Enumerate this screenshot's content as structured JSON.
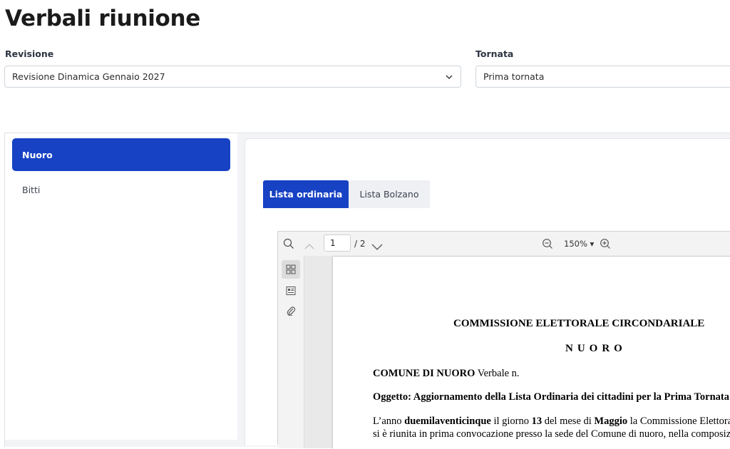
{
  "page": {
    "title": "Verbali riunione"
  },
  "filters": {
    "revisione": {
      "label": "Revisione",
      "value": "Revisione Dinamica Gennaio 2027"
    },
    "tornata": {
      "label": "Tornata",
      "value": "Prima tornata"
    }
  },
  "sidebar": {
    "items": [
      {
        "label": "Nuoro",
        "active": true
      },
      {
        "label": "Bitti",
        "active": false
      }
    ]
  },
  "tabs": [
    {
      "label": "Lista ordinaria",
      "active": true
    },
    {
      "label": "Lista Bolzano",
      "active": false
    }
  ],
  "viewer": {
    "current_page": "1",
    "total_pages": "/ 2",
    "zoom": "150%",
    "zoom_caret": "▾",
    "icons": [
      "search-icon",
      "chevron-up-icon",
      "chevron-down-icon",
      "zoom-out-icon",
      "zoom-in-icon",
      "thumbnails-icon",
      "outline-icon",
      "attachment-icon"
    ]
  },
  "document": {
    "heading": "COMMISSIONE ELETTORALE CIRCONDARIALE",
    "subheading": "NUORO",
    "comune_bold": "COMUNE DI NUORO",
    "comune_rest": " Verbale n.",
    "oggetto": "Oggetto: Aggiornamento della Lista Ordinaria dei cittadini per la Prima Tornata",
    "p1_a": "L’anno ",
    "p1_b": "duemilaventicinque",
    "p1_c": " il giorno ",
    "p1_d": "13",
    "p1_e": " del mese di ",
    "p1_f": "Maggio",
    "p1_g": " la Commissione Elettorale",
    "p2": "si è riunita in prima convocazione presso la sede del Comune di nuoro, nella composizione"
  },
  "colors": {
    "accent": "#1742c4",
    "inactive_tab": "#eef0f3",
    "panel_bg": "#f3f4f6"
  }
}
